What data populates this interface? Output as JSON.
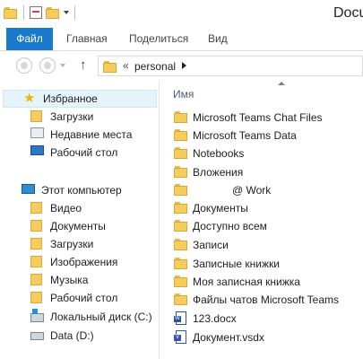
{
  "window": {
    "title": "Docu"
  },
  "ribbon": {
    "tabs": [
      {
        "label": "Файл"
      },
      {
        "label": "Главная"
      },
      {
        "label": "Поделиться"
      },
      {
        "label": "Вид"
      }
    ]
  },
  "address": {
    "separator": "«",
    "path": "personal"
  },
  "nav": {
    "favorites_label": "Избранное",
    "favorites": [
      {
        "label": "Загрузки"
      },
      {
        "label": "Недавние места"
      },
      {
        "label": "Рабочий стол"
      }
    ],
    "computer_label": "Этот компьютер",
    "computer": [
      {
        "label": "Видео"
      },
      {
        "label": "Документы"
      },
      {
        "label": "Загрузки"
      },
      {
        "label": "Изображения"
      },
      {
        "label": "Музыка"
      },
      {
        "label": "Рабочий стол"
      },
      {
        "label": "Локальный диск (C:)"
      },
      {
        "label": "Data (D:)"
      }
    ]
  },
  "content": {
    "column_name": "Имя",
    "files": [
      {
        "name": "Microsoft Teams Chat Files",
        "type": "folder"
      },
      {
        "name": "Microsoft Teams Data",
        "type": "folder"
      },
      {
        "name": "Notebooks",
        "type": "folder"
      },
      {
        "name": "Вложения",
        "type": "folder"
      },
      {
        "name": "@ Work",
        "type": "folder"
      },
      {
        "name": "Документы",
        "type": "folder"
      },
      {
        "name": "Доступно всем",
        "type": "folder"
      },
      {
        "name": "Записи",
        "type": "folder"
      },
      {
        "name": "Записные книжки",
        "type": "folder"
      },
      {
        "name": "Моя записная книжка",
        "type": "folder"
      },
      {
        "name": "Файлы чатов Microsoft Teams",
        "type": "folder"
      },
      {
        "name": "123.docx",
        "type": "docx"
      },
      {
        "name": "Документ.vsdx",
        "type": "vsdx"
      }
    ]
  },
  "colors": {
    "accent": "#1979ca",
    "selection": "#e5f3fb",
    "folder": "#f6cd5c"
  }
}
